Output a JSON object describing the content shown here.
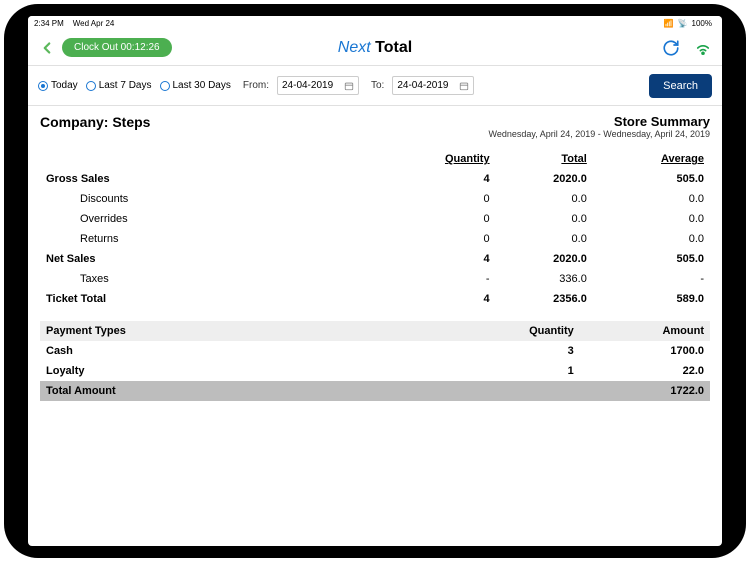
{
  "status": {
    "time": "2:34 PM",
    "date": "Wed Apr 24",
    "signal": "•••",
    "wifi": "100%",
    "battery_label": "100%"
  },
  "nav": {
    "clock_out": "Clock Out 00:12:26",
    "brand_next": "Next",
    "brand_total": " Total"
  },
  "filter": {
    "today": "Today",
    "last7": "Last 7 Days",
    "last30": "Last 30 Days",
    "from_label": "From:",
    "to_label": "To:",
    "from_value": "24-04-2019",
    "to_value": "24-04-2019",
    "search": "Search"
  },
  "header": {
    "company_label": "Company: Steps",
    "summary_title": "Store Summary",
    "summary_dates": "Wednesday, April 24, 2019 - Wednesday, April 24, 2019"
  },
  "cols": {
    "qty": "Quantity",
    "total": "Total",
    "avg": "Average"
  },
  "rows": {
    "gross": {
      "label": "Gross Sales",
      "qty": "4",
      "total": "2020.0",
      "avg": "505.0"
    },
    "disc": {
      "label": "Discounts",
      "qty": "0",
      "total": "0.0",
      "avg": "0.0"
    },
    "over": {
      "label": "Overrides",
      "qty": "0",
      "total": "0.0",
      "avg": "0.0"
    },
    "ret": {
      "label": "Returns",
      "qty": "0",
      "total": "0.0",
      "avg": "0.0"
    },
    "net": {
      "label": "Net Sales",
      "qty": "4",
      "total": "2020.0",
      "avg": "505.0"
    },
    "tax": {
      "label": "Taxes",
      "qty": "-",
      "total": "336.0",
      "avg": "-"
    },
    "ticket": {
      "label": "Ticket Total",
      "qty": "4",
      "total": "2356.0",
      "avg": "589.0"
    }
  },
  "pay": {
    "head": {
      "label": "Payment Types",
      "qty": "Quantity",
      "amt": "Amount"
    },
    "cash": {
      "label": "Cash",
      "qty": "3",
      "amt": "1700.0"
    },
    "loyal": {
      "label": "Loyalty",
      "qty": "1",
      "amt": "22.0"
    },
    "total": {
      "label": "Total Amount",
      "amt": "1722.0"
    }
  }
}
